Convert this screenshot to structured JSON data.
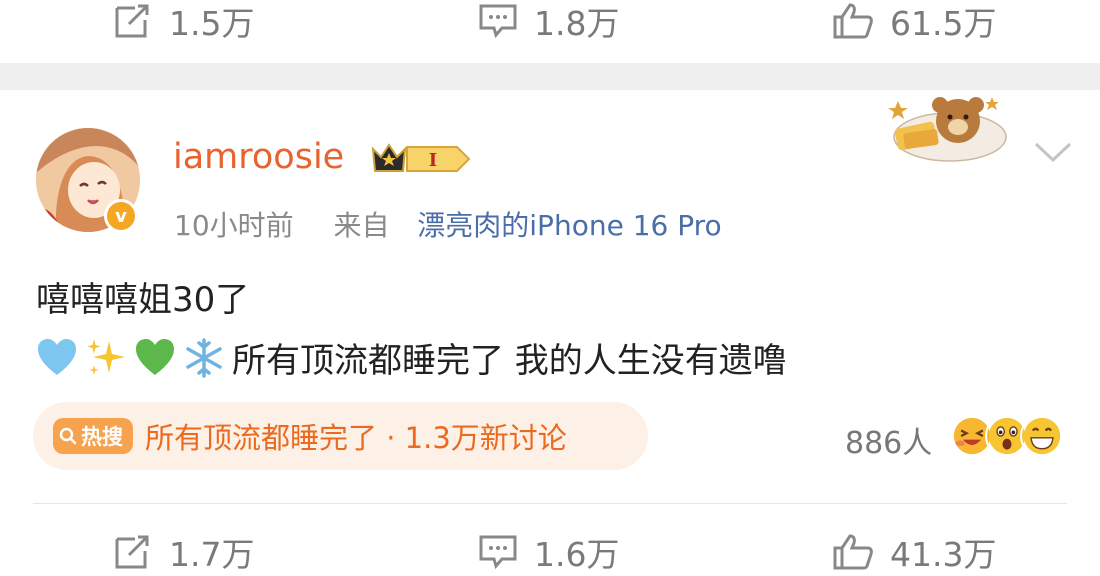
{
  "top_actions": {
    "repost_count": "1.5万",
    "comment_count": "1.8万",
    "like_count": "61.5万"
  },
  "post": {
    "username": "iamroosie",
    "vip_level": "I",
    "time": "10小时前",
    "source_prefix": "来自",
    "source_device": "漂亮肉的iPhone 16 Pro",
    "text_line1": "嘻嘻嘻姐30了",
    "text_line2": "所有顶流都睡完了 我的人生没有遗噜",
    "emojis": [
      "light-blue-heart",
      "sparkles",
      "green-heart",
      "snowflake"
    ]
  },
  "hot_search": {
    "badge_label": "热搜",
    "text": "所有顶流都睡完了 · 1.3万新讨论"
  },
  "reactions": {
    "count_text": "886人"
  },
  "bottom_actions": {
    "repost_count": "1.7万",
    "comment_count": "1.6万",
    "like_count": "41.3万"
  },
  "colors": {
    "username": "#e8632e",
    "device_link": "#4a6ea9",
    "hot_text": "#ea6b1f",
    "hot_bg": "#fdf0e6",
    "verified_badge": "#f5a623"
  }
}
